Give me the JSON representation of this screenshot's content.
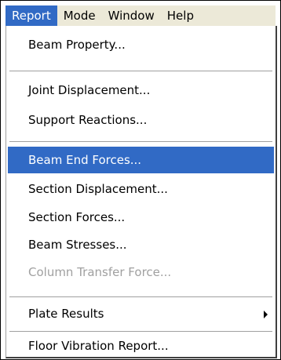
{
  "menubar": {
    "items": [
      {
        "label": "Report"
      },
      {
        "label": "Mode"
      },
      {
        "label": "Window"
      },
      {
        "label": "Help"
      }
    ]
  },
  "menu": {
    "items": [
      {
        "label": "Beam Property..."
      },
      {
        "label": "Joint Displacement..."
      },
      {
        "label": "Support Reactions..."
      },
      {
        "label": "Beam End Forces..."
      },
      {
        "label": "Section Displacement..."
      },
      {
        "label": "Section Forces..."
      },
      {
        "label": "Beam Stresses..."
      },
      {
        "label": "Column Transfer Force..."
      },
      {
        "label": "Plate Results"
      },
      {
        "label": "Floor Vibration Report..."
      }
    ]
  },
  "colors": {
    "highlight": "#316ac5",
    "disabled_text": "#a0a0a0",
    "menubar_bg": "#ece9d8"
  },
  "icons": {
    "submenu": "chevron-right-icon"
  }
}
